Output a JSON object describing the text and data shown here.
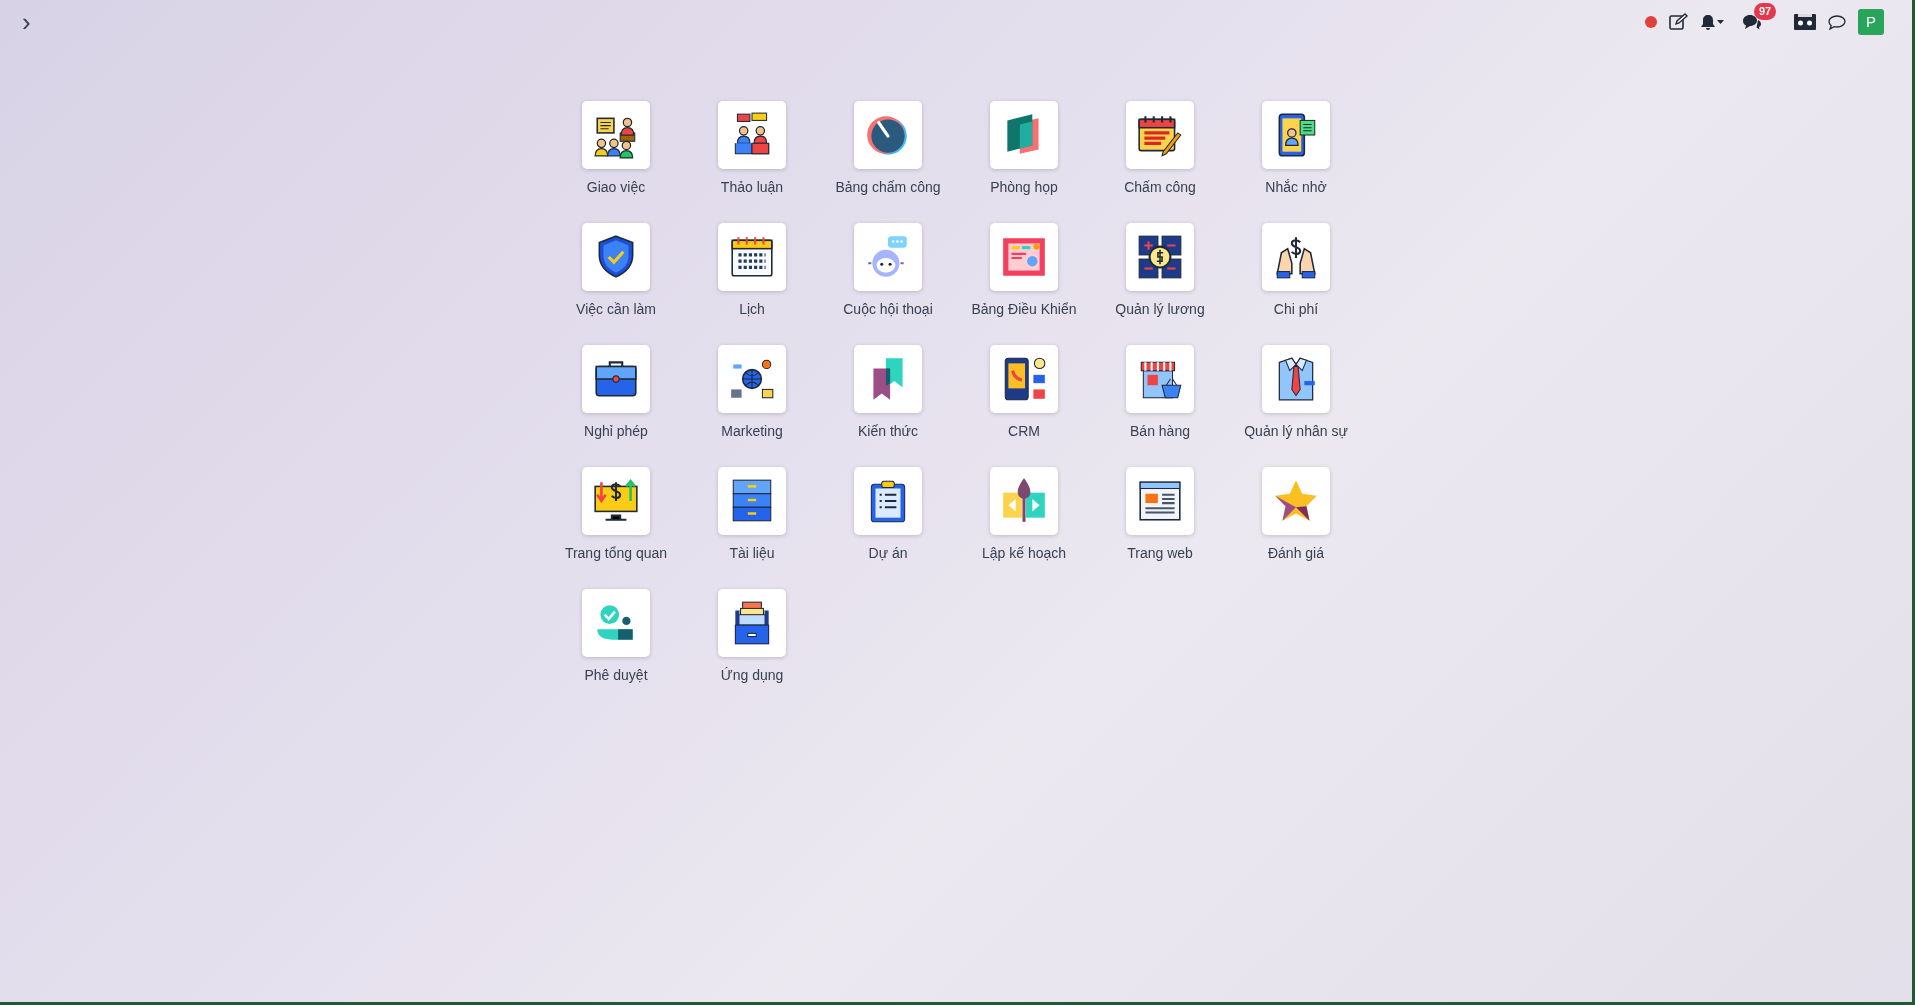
{
  "topbar": {
    "toggle": "›",
    "chat_badge": "97",
    "avatar": "P"
  },
  "apps": [
    {
      "label": "Giao việc"
    },
    {
      "label": "Thảo luận"
    },
    {
      "label": "Bảng chấm công"
    },
    {
      "label": "Phòng họp"
    },
    {
      "label": "Chấm công"
    },
    {
      "label": "Nhắc nhở"
    },
    {
      "label": "Việc cần làm"
    },
    {
      "label": "Lịch"
    },
    {
      "label": "Cuộc hội thoại"
    },
    {
      "label": "Bảng Điều Khiển"
    },
    {
      "label": "Quản lý lương"
    },
    {
      "label": "Chi phí"
    },
    {
      "label": "Nghỉ phép"
    },
    {
      "label": "Marketing"
    },
    {
      "label": "Kiến thức"
    },
    {
      "label": "CRM"
    },
    {
      "label": "Bán hàng"
    },
    {
      "label": "Quản lý nhân sự"
    },
    {
      "label": "Trang tổng quan"
    },
    {
      "label": "Tài liệu"
    },
    {
      "label": "Dự án"
    },
    {
      "label": "Lập kế hoạch"
    },
    {
      "label": "Trang web"
    },
    {
      "label": "Đánh giá"
    },
    {
      "label": "Phê duyệt"
    },
    {
      "label": "Ứng dụng"
    }
  ]
}
